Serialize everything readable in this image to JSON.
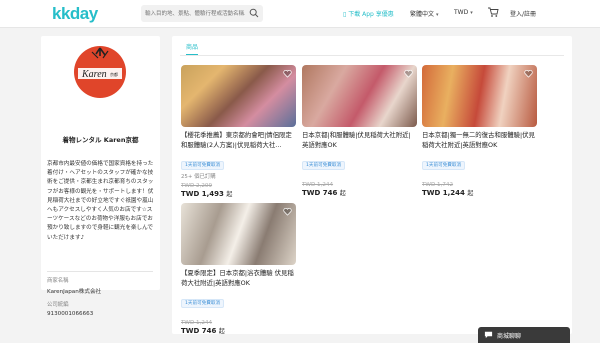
{
  "header": {
    "logo": "kkday",
    "search_placeholder": "輸入目的地、景點、體驗行程或活動名稱...",
    "app_label": "下載 App 享優惠",
    "language": "繁體中文",
    "currency": "TWD",
    "login": "登入/註冊"
  },
  "shop": {
    "logo_text": "Karen",
    "logo_sub": "京都",
    "name": "着物レンタル Karen京都",
    "description": "京都市内最安値の価格で国家資格を持った着付け・ヘアセットのスタッフが確かな技術をご提供・京都生まれ京都育ちのスタッフがお客様の観光を・サポートします！伏見稲荷大社までの好立地ですぐ祇園や嵐山へもアクセスしやすく人気のお店です☆スーツケースなどのお荷物や洋服もお店でお預かり致しますので身軽に観光を楽しんでいただけます♪",
    "company_label": "商家名稱",
    "company_value": "KarenJapan株式会社",
    "reg_label": "公司統編",
    "reg_value": "9130001066663"
  },
  "tabs": {
    "products": "商品"
  },
  "products": [
    {
      "title": "【櫻花季推薦】東京都約會吧|情侶限定和服體驗(2人方案)|伏見稲荷大社...",
      "badge": "1天前可免費取消",
      "rating": "25+ 個已訂購",
      "old_price": "TWD 2,209",
      "price": "TWD 1,493",
      "unit": "起"
    },
    {
      "title": "日本京都|和服體驗|伏見稲荷大社附近|英語對應OK",
      "badge": "1天前可免費取消",
      "rating": "",
      "old_price": "TWD 1,244",
      "price": "TWD 746",
      "unit": "起"
    },
    {
      "title": "日本京都|獨一無二的復古和服體驗|伏見稲荷大社附近|英語對應OK",
      "badge": "1天前可免費取消",
      "rating": "",
      "old_price": "TWD 1,742",
      "price": "TWD 1,244",
      "unit": "起"
    },
    {
      "title": "【夏季限定】日本京都|浴衣體驗 伏見稲荷大社附近|英語對應OK",
      "badge": "1天前可免費取消",
      "rating": "",
      "old_price": "TWD 1,244",
      "price": "TWD 746",
      "unit": "起"
    }
  ],
  "chat": {
    "label": "商城聊聊"
  },
  "colors": {
    "brand": "#26bec9",
    "logo_red": "#e0452a"
  }
}
